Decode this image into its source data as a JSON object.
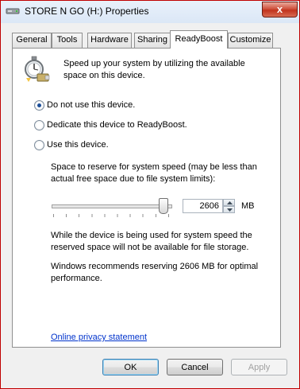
{
  "window": {
    "title": "STORE N GO (H:) Properties",
    "close_symbol": "x",
    "icon": "drive-icon"
  },
  "tabs": [
    {
      "label": "General",
      "active": false
    },
    {
      "label": "Tools",
      "active": false
    },
    {
      "label": "Hardware",
      "active": false
    },
    {
      "label": "Sharing",
      "active": false
    },
    {
      "label": "ReadyBoost",
      "active": true
    },
    {
      "label": "Customize",
      "active": false
    }
  ],
  "readyboost": {
    "icon": "readyboost-stopwatch-icon",
    "description": "Speed up your system by utilizing the available space on this device.",
    "options": [
      {
        "label": "Do not use this device.",
        "checked": true
      },
      {
        "label": "Dedicate this device to ReadyBoost.",
        "checked": false
      },
      {
        "label": "Use this device.",
        "checked": false
      }
    ],
    "reserve_label": "Space to reserve for system speed (may be less than actual free space due to file system limits):",
    "slider_fraction": 0.94,
    "reserve_value": "2606",
    "unit": "MB",
    "info_text": "While the device is being used for system speed the reserved space will not be available for file storage.",
    "recommendation": "Windows recommends reserving 2606 MB for optimal performance.",
    "privacy_link": "Online privacy statement"
  },
  "buttons": {
    "ok": "OK",
    "cancel": "Cancel",
    "apply": "Apply"
  },
  "colors": {
    "link": "#0033cc",
    "radio_dot": "#1c4f99",
    "close_button": "#c1331d"
  }
}
